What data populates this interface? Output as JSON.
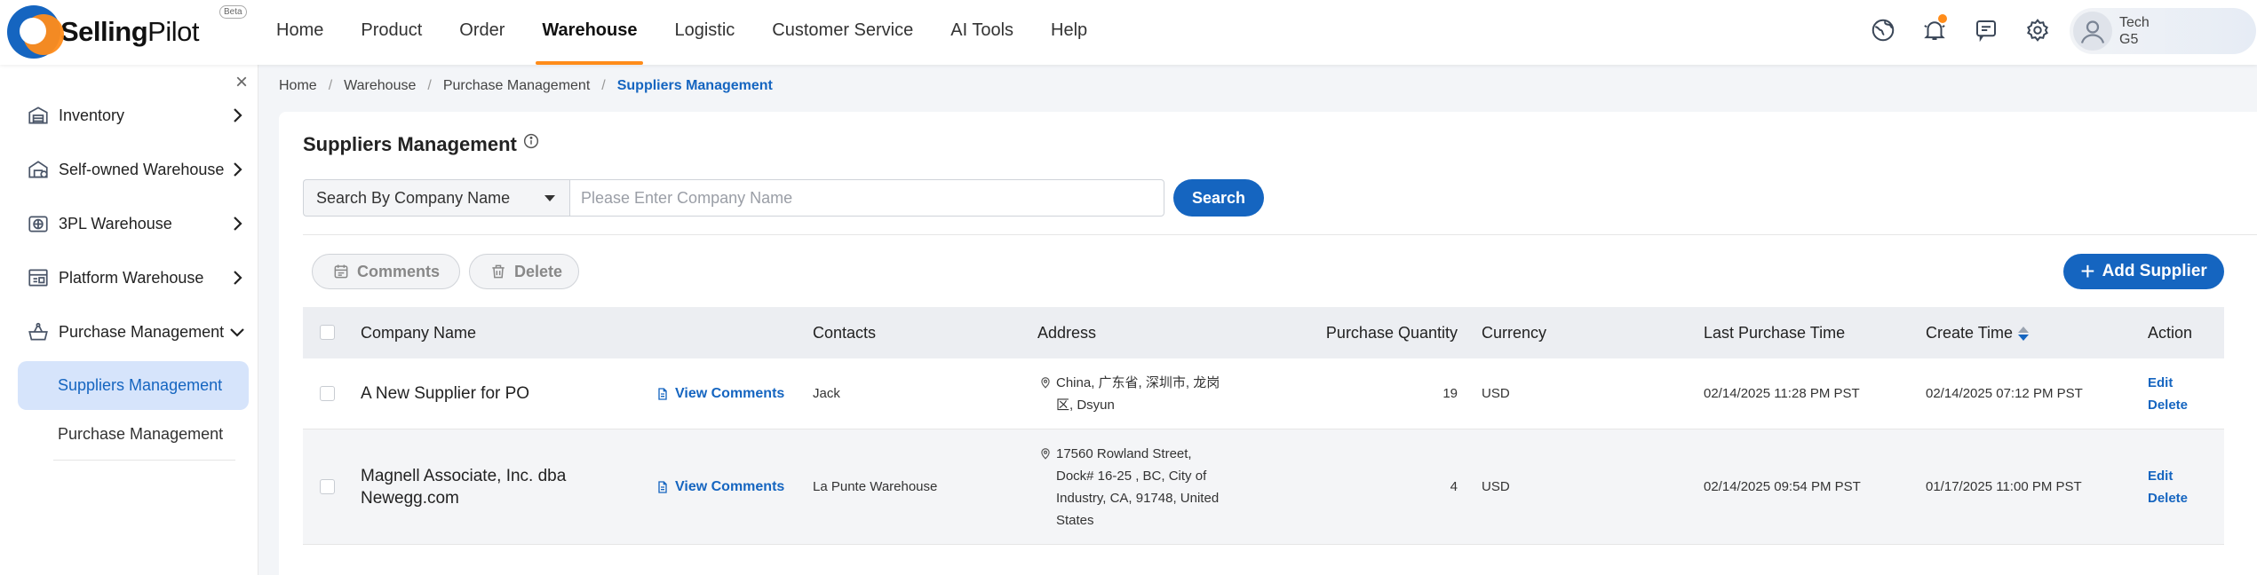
{
  "brand": {
    "name_bold": "Selling",
    "name_light": "Pilot",
    "beta": "Beta"
  },
  "nav": {
    "items": [
      {
        "label": "Home"
      },
      {
        "label": "Product"
      },
      {
        "label": "Order"
      },
      {
        "label": "Warehouse",
        "active": true
      },
      {
        "label": "Logistic"
      },
      {
        "label": "Customer Service"
      },
      {
        "label": "AI Tools"
      },
      {
        "label": "Help"
      }
    ]
  },
  "top_icons": [
    "globe-icon",
    "bell-icon",
    "chat-icon",
    "gear-icon"
  ],
  "user": {
    "line1": "Tech",
    "line2": "G5"
  },
  "sidebar": {
    "close": "×",
    "items": [
      {
        "label": "Inventory",
        "icon": "inventory-icon"
      },
      {
        "label": "Self-owned Warehouse",
        "icon": "warehouse-icon"
      },
      {
        "label": "3PL Warehouse",
        "icon": "globe-box-icon"
      },
      {
        "label": "Platform Warehouse",
        "icon": "platform-icon"
      },
      {
        "label": "Purchase Management",
        "icon": "purchase-icon",
        "expanded": true
      }
    ],
    "sub_items": [
      {
        "label": "Suppliers Management",
        "active": true
      },
      {
        "label": "Purchase Management"
      }
    ]
  },
  "breadcrumb": [
    "Home",
    "Warehouse",
    "Purchase Management",
    "Suppliers Management"
  ],
  "page": {
    "title": "Suppliers Management",
    "search_type": "Search By Company Name",
    "search_placeholder": "Please Enter Company Name",
    "search_button": "Search",
    "comments_button": "Comments",
    "delete_button": "Delete",
    "add_button": "Add Supplier"
  },
  "table": {
    "headers": {
      "company": "Company Name",
      "contacts": "Contacts",
      "address": "Address",
      "quantity": "Purchase Quantity",
      "currency": "Currency",
      "last_purchase": "Last Purchase Time",
      "create_time": "Create Time",
      "action": "Action"
    },
    "rows": [
      {
        "company_line1": "A New Supplier for PO",
        "company_line2": "",
        "view_comments": "View Comments",
        "contacts": "Jack",
        "address_lines": [
          "China, 广东省, 深圳市, 龙岗",
          "区, Dsyun"
        ],
        "quantity": "19",
        "currency": "USD",
        "last_purchase": "02/14/2025 11:28 PM PST",
        "create_time": "02/14/2025 07:12 PM PST",
        "edit": "Edit",
        "delete": "Delete"
      },
      {
        "company_line1": "Magnell Associate, Inc. dba",
        "company_line2": "Newegg.com",
        "view_comments": "View Comments",
        "contacts": "La Punte Warehouse",
        "address_lines": [
          "17560 Rowland Street,",
          "Dock# 16-25 , BC, City of",
          "Industry, CA, 91748, United",
          "States"
        ],
        "quantity": "4",
        "currency": "USD",
        "last_purchase": "02/14/2025 09:54 PM PST",
        "create_time": "01/17/2025 11:00 PM PST",
        "edit": "Edit",
        "delete": "Delete"
      }
    ]
  },
  "colors": {
    "primary": "#1565c0",
    "accent": "#ff8c1a",
    "active_bg": "#d6e4fb"
  }
}
